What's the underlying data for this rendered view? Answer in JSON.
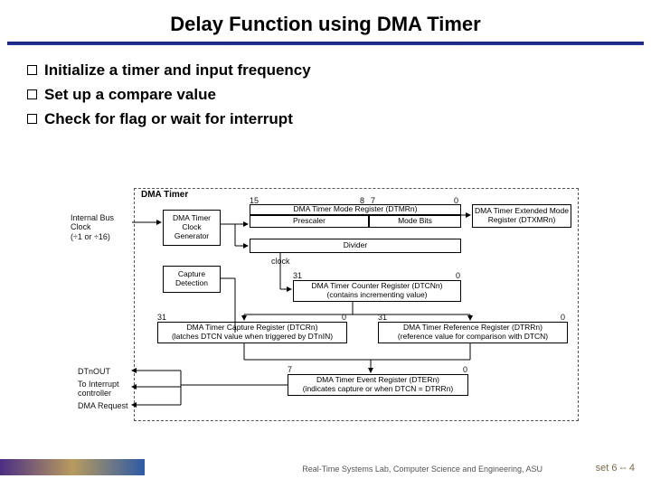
{
  "title": "Delay Function using DMA Timer",
  "bullets": [
    "Initialize a timer and input frequency",
    "Set up a compare value",
    "Check for flag or wait for interrupt"
  ],
  "diagram": {
    "title": "DMA Timer",
    "left_input": "Internal Bus Clock",
    "left_input_sub": "(÷1 or ÷16)",
    "clock_gen": "DMA Timer\nClock\nGenerator",
    "capture": "Capture\nDetection",
    "clock_out": "clock",
    "num_top_15": "15",
    "num_top_8": "8",
    "num_top_7": "7",
    "num_top_0": "0",
    "tmr": "DMA Timer Mode Register (DTMRn)",
    "tmr_left": "Prescaler",
    "tmr_right": "Mode Bits",
    "xmr": "DMA Timer Extended Mode\nRegister (DTXMRn)",
    "divider": "Divider",
    "num31": "31",
    "num0b": "0",
    "dtcn": "DMA Timer Counter Register (DTCNn)\n(contains incrementing value)",
    "dtcr_num_l": "31",
    "dtcr_num_r": "0",
    "dtcr": "DMA Timer Capture Register (DTCRn)\n(latches DTCN value when triggered by DTnIN)",
    "dtrr_num_l": "31",
    "dtrr_num_r": "0",
    "dtrr": "DMA Timer Reference Register (DTRRn)\n(reference value for comparison with DTCN)",
    "ev_num_l": "7",
    "ev_num_r": "0",
    "dter": "DMA Timer Event Register (DTERn)\n(indicates capture or when DTCN = DTRRn)",
    "out1": "DTnOUT",
    "out2": "To Interrupt\ncontroller",
    "out3": "DMA Request"
  },
  "footer": "Real-Time Systems Lab, Computer Science and Engineering, ASU",
  "page": "set 6 -- 4"
}
